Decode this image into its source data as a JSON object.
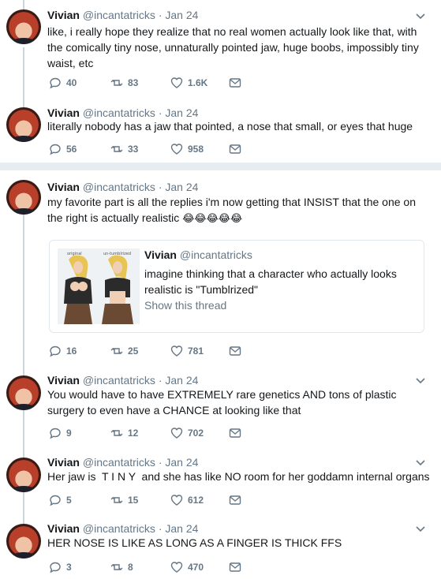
{
  "tweets": [
    {
      "name": "Vivian",
      "handle": "@incantatricks",
      "date": "· Jan 24",
      "text": "like, i really hope they realize that no real women actually look like that, with the comically tiny nose, unnaturally pointed jaw, huge boobs, impossibly tiny waist, etc",
      "replies": "40",
      "retweets": "83",
      "likes": "1.6K"
    },
    {
      "name": "Vivian",
      "handle": "@incantatricks",
      "date": "· Jan 24",
      "text": "literally nobody has a jaw that pointed, a nose that small, or eyes that huge",
      "replies": "56",
      "retweets": "33",
      "likes": "958"
    },
    {
      "name": "Vivian",
      "handle": "@incantatricks",
      "date": "· Jan 24",
      "text": "my favorite part is all the replies i'm now getting that INSIST that the one on the right is actually realistic",
      "emoji": "😂😂😂😂😂",
      "replies": "16",
      "retweets": "25",
      "likes": "781",
      "quote": {
        "name": "Vivian",
        "handle": "@incantatricks",
        "text": "imagine thinking that a character who actually looks realistic is \"Tumblrized\"",
        "link": "Show this thread",
        "image_labels": [
          "original",
          "un-tumblrized"
        ]
      }
    },
    {
      "name": "Vivian",
      "handle": "@incantatricks",
      "date": "· Jan 24",
      "text": "You would have to have EXTREMELY rare genetics AND tons of plastic surgery to even have a CHANCE at looking like that",
      "replies": "9",
      "retweets": "12",
      "likes": "702"
    },
    {
      "name": "Vivian",
      "handle": "@incantatricks",
      "date": "· Jan 24",
      "text": "Her jaw is  T I N Y  and she has like NO room for her goddamn internal organs",
      "replies": "5",
      "retweets": "15",
      "likes": "612"
    },
    {
      "name": "Vivian",
      "handle": "@incantatricks",
      "date": "· Jan 24",
      "text": "HER NOSE IS LIKE AS LONG AS A FINGER IS THICK FFS",
      "replies": "3",
      "retweets": "8",
      "likes": "470"
    }
  ],
  "colors": {
    "thread_line": "#ccd6dd",
    "muted": "#657786",
    "divider": "#e6ecf0"
  }
}
